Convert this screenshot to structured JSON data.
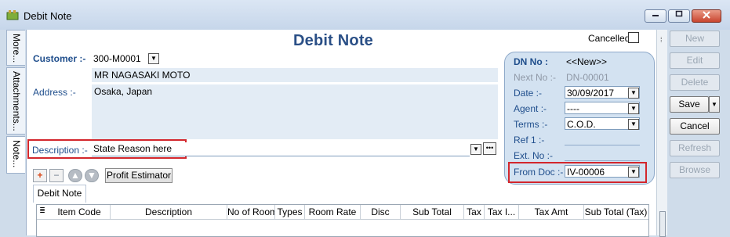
{
  "window": {
    "title": "Debit Note"
  },
  "side_tabs": [
    "More...",
    "Attachments...",
    "Note..."
  ],
  "form": {
    "title": "Debit Note",
    "cancelled_label": "Cancelled",
    "customer": {
      "label": "Customer :-",
      "code": "300-M0001",
      "name": "MR NAGASAKI MOTO"
    },
    "address": {
      "label": "Address :-",
      "line1": "Osaka, Japan"
    },
    "description": {
      "label": "Description :-",
      "value": "State Reason here"
    }
  },
  "doc_header": {
    "dn_no": {
      "label": "DN No :",
      "value": "<<New>>"
    },
    "next_no": {
      "label": "Next No :-",
      "value": "DN-00001"
    },
    "date": {
      "label": "Date :-",
      "value": "30/09/2017"
    },
    "agent": {
      "label": "Agent :-",
      "value": "----"
    },
    "terms": {
      "label": "Terms :-",
      "value": "C.O.D."
    },
    "ref1": {
      "label": "Ref 1 :-",
      "value": ""
    },
    "ext_no": {
      "label": "Ext. No :-",
      "value": ""
    },
    "from_doc": {
      "label": "From Doc :-",
      "value": "IV-00006"
    }
  },
  "toolbar": {
    "profit_estimator": "Profit Estimator"
  },
  "detail_tab": "Debit Note",
  "grid_columns": [
    "Item Code",
    "Description",
    "No of Room",
    "Types",
    "Room Rate",
    "Disc",
    "Sub Total",
    "Tax",
    "Tax I...",
    "Tax Amt",
    "Sub Total (Tax)"
  ],
  "actions": {
    "new": "New",
    "edit": "Edit",
    "delete": "Delete",
    "save": "Save",
    "cancel": "Cancel",
    "refresh": "Refresh",
    "browse": "Browse"
  },
  "colors": {
    "highlight_box": "#d3262c",
    "title_blue": "#2a4f86"
  }
}
